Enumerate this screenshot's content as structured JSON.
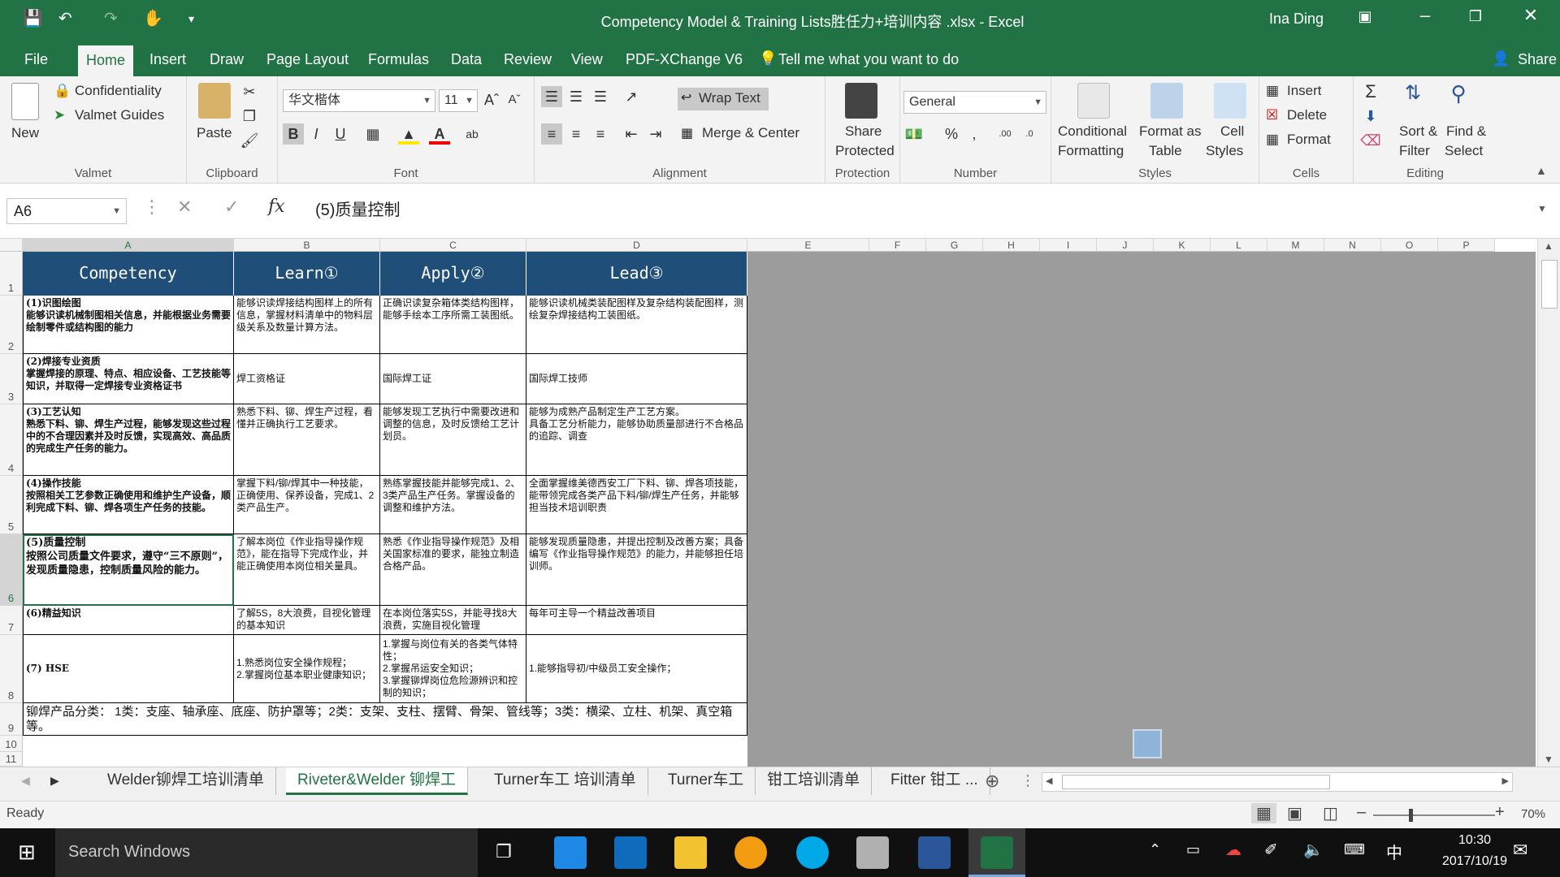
{
  "window": {
    "title": "Competency Model & Training Lists胜任力+培训内容 .xlsx  -  Excel",
    "user": "Ina Ding"
  },
  "ribbon_tabs": [
    "File",
    "Home",
    "Insert",
    "Draw",
    "Page Layout",
    "Formulas",
    "Data",
    "Review",
    "View",
    "PDF-XChange V6"
  ],
  "tell_me": "Tell me what you want to do",
  "share": "Share",
  "ribbon": {
    "new": "New",
    "confidentiality": "Confidentiality",
    "valmet_guides": "Valmet Guides",
    "group_valmet": "Valmet",
    "paste": "Paste",
    "group_clipboard": "Clipboard",
    "font_name": "华文楷体",
    "font_size": "11",
    "group_font": "Font",
    "wrap_text": "Wrap Text",
    "merge_center": "Merge & Center",
    "group_alignment": "Alignment",
    "share_protected_1": "Share",
    "share_protected_2": "Protected",
    "group_protection": "Protection",
    "number_format": "General",
    "group_number": "Number",
    "conditional_1": "Conditional",
    "conditional_2": "Formatting",
    "format_table_1": "Format as",
    "format_table_2": "Table",
    "cell_styles_1": "Cell",
    "cell_styles_2": "Styles",
    "group_styles": "Styles",
    "insert": "Insert",
    "delete": "Delete",
    "format": "Format",
    "group_cells": "Cells",
    "sort_1": "Sort &",
    "sort_2": "Filter",
    "find_1": "Find &",
    "find_2": "Select",
    "group_editing": "Editing"
  },
  "formula_bar": {
    "name_box": "A6",
    "fx": "fx",
    "content": "(5)质量控制"
  },
  "columns": [
    "A",
    "B",
    "C",
    "D",
    "E",
    "F",
    "G",
    "H",
    "I",
    "J",
    "K",
    "L",
    "M",
    "N",
    "O",
    "P"
  ],
  "rows": [
    "1",
    "2",
    "3",
    "4",
    "5",
    "6",
    "7",
    "8",
    "9",
    "10",
    "11"
  ],
  "table_header": [
    "Competency",
    "Learn①",
    "Apply②",
    "Lead③"
  ],
  "table_rows": [
    [
      "(1)识图绘图\n能够识读机械制图相关信息，并能根据业务需要绘制零件或结构图的能力",
      "能够识读焊接结构图样上的所有信息，掌握材料清单中的物料层级关系及数量计算方法。",
      "正确识读复杂箱体类结构图样，能够手绘本工序所需工装图纸。",
      "能够识读机械类装配图样及复杂结构装配图样，测绘复杂焊接结构工装图纸。"
    ],
    [
      "(2)焊接专业资质\n掌握焊接的原理、特点、相应设备、工艺技能等知识，并取得一定焊接专业资格证书",
      "焊工资格证",
      "国际焊工证",
      "国际焊工技师"
    ],
    [
      "(3)工艺认知\n熟悉下料、铆、焊生产过程，能够发现这些过程中的不合理因素并及时反馈，实现高效、高品质的完成生产任务的能力。",
      "熟悉下料、铆、焊生产过程，看懂并正确执行工艺要求。",
      "能够发现工艺执行中需要改进和调整的信息，及时反馈给工艺计划员。",
      "能够为成熟产品制定生产工艺方案。\n具备工艺分析能力，能够协助质量部进行不合格品的追踪、调查"
    ],
    [
      "(4)操作技能\n按照相关工艺参数正确使用和维护生产设备，顺利完成下料、铆、焊各项生产任务的技能。",
      "掌握下料/铆/焊其中一种技能，正确使用、保养设备，完成1、2类产品生产。",
      "熟练掌握技能并能够完成1、2、3类产品生产任务。掌握设备的调整和维护方法。",
      "全面掌握维美德西安工厂下料、铆、焊各项技能，能带领完成各类产品下料/铆/焊生产任务，并能够担当技术培训职责"
    ],
    [
      "(5)质量控制\n按照公司质量文件要求，遵守“三不原则”，发现质量隐患，控制质量风险的能力。",
      "了解本岗位《作业指导操作规范》，能在指导下完成作业，并能正确使用本岗位相关量具。",
      "熟悉《作业指导操作规范》及相关国家标准的要求，能独立制造合格产品。",
      "能够发现质量隐患，并提出控制及改善方案；具备编写《作业指导操作规范》的能力，并能够担任培训师。"
    ],
    [
      "(6)精益知识",
      "了解5S，8大浪费，目视化管理的基本知识",
      "在本岗位落实5S，并能寻找8大浪费，实施目视化管理",
      "每年可主导一个精益改善项目"
    ],
    [
      "(7) HSE",
      "1.熟悉岗位安全操作规程；\n2.掌握岗位基本职业健康知识；",
      "1.掌握与岗位有关的各类气体特性；\n2.掌握吊运安全知识；\n3.掌握铆焊岗位危险源辨识和控制的知识；",
      "1.能够指导初/中级员工安全操作；"
    ]
  ],
  "footer_note": "铆焊产品分类： 1类：支座、轴承座、底座、防护罩等；2类：支架、支柱、摆臂、骨架、管线等；3类：横梁、立柱、机架、真空箱等。",
  "sheet_tabs": [
    "Welder铆焊工培训清单",
    "Riveter&Welder 铆焊工",
    "Turner车工 培训清单",
    "Turner车工",
    "钳工培训清单",
    "Fitter 钳工 ..."
  ],
  "active_sheet": 1,
  "status": {
    "ready": "Ready",
    "zoom": "70%"
  },
  "taskbar": {
    "search": "Search Windows",
    "time": "10:30",
    "date": "2017/10/19",
    "ime": "中"
  }
}
